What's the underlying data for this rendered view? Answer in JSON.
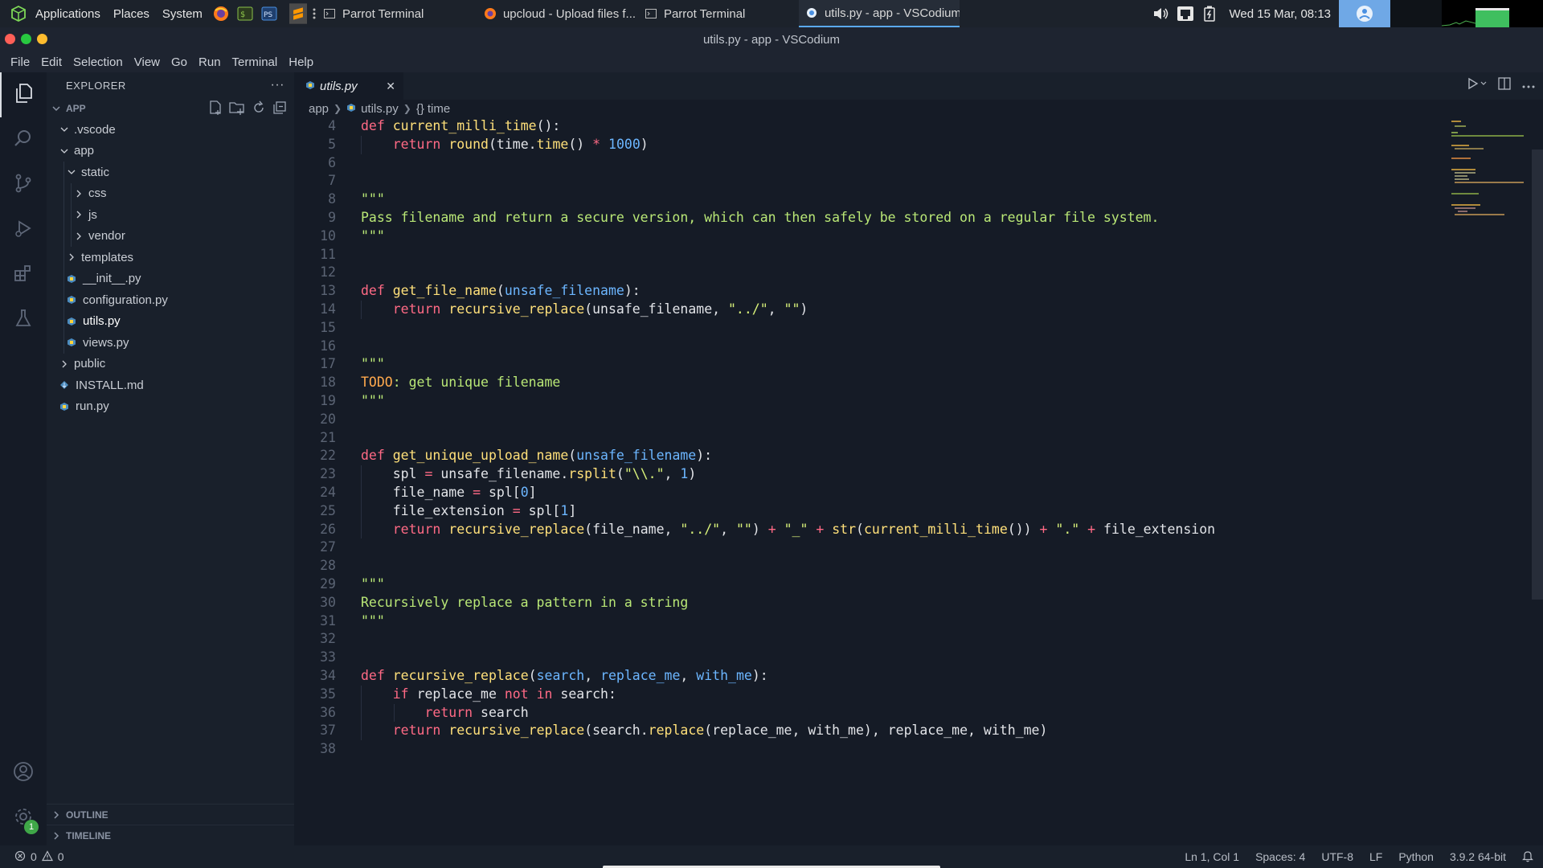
{
  "os_panel": {
    "menus": [
      "Applications",
      "Places",
      "System"
    ],
    "tasks": [
      {
        "label": "Parrot Terminal",
        "icon": "terminal-icon",
        "active": false
      },
      {
        "label": "upcloud - Upload files f...",
        "icon": "firefox-icon",
        "active": false
      },
      {
        "label": "Parrot Terminal",
        "icon": "terminal-icon",
        "active": false
      },
      {
        "label": "utils.py - app - VSCodium",
        "icon": "vscodium-icon",
        "active": true
      }
    ],
    "clock": "Wed 15 Mar, 08:13"
  },
  "window": {
    "title": "utils.py - app - VSCodium"
  },
  "menubar": [
    "File",
    "Edit",
    "Selection",
    "View",
    "Go",
    "Run",
    "Terminal",
    "Help"
  ],
  "sidebar": {
    "title": "EXPLORER",
    "more": "···",
    "section": "APP",
    "tree": [
      {
        "label": ".vscode",
        "type": "folder",
        "open": true,
        "depth": 0
      },
      {
        "label": "app",
        "type": "folder",
        "open": true,
        "depth": 0
      },
      {
        "label": "static",
        "type": "folder",
        "open": true,
        "depth": 1
      },
      {
        "label": "css",
        "type": "folder",
        "open": false,
        "depth": 2
      },
      {
        "label": "js",
        "type": "folder",
        "open": false,
        "depth": 2
      },
      {
        "label": "vendor",
        "type": "folder",
        "open": false,
        "depth": 2
      },
      {
        "label": "templates",
        "type": "folder",
        "open": false,
        "depth": 1
      },
      {
        "label": "__init__.py",
        "type": "py",
        "depth": 1
      },
      {
        "label": "configuration.py",
        "type": "py",
        "depth": 1
      },
      {
        "label": "utils.py",
        "type": "py",
        "depth": 1,
        "active": true
      },
      {
        "label": "views.py",
        "type": "py",
        "depth": 1
      },
      {
        "label": "public",
        "type": "folder",
        "open": false,
        "depth": 0
      },
      {
        "label": "INSTALL.md",
        "type": "md",
        "depth": 0
      },
      {
        "label": "run.py",
        "type": "py",
        "depth": 0
      }
    ],
    "outline": "OUTLINE",
    "timeline": "TIMELINE"
  },
  "editor": {
    "tab": {
      "label": "utils.py",
      "close": "✕"
    },
    "breadcrumb": {
      "folder": "app",
      "file": "utils.py",
      "symbol": "time"
    },
    "lines": [
      {
        "n": "4",
        "tokens": [
          [
            "kw",
            "def "
          ],
          [
            "fn",
            "current_milli_time"
          ],
          [
            "df",
            "():"
          ]
        ]
      },
      {
        "n": "5",
        "tokens": [
          [
            "df",
            "    "
          ],
          [
            "kw",
            "return "
          ],
          [
            "fn",
            "round"
          ],
          [
            "df",
            "(time."
          ],
          [
            "fn",
            "time"
          ],
          [
            "df",
            "() "
          ],
          [
            "op",
            "* "
          ],
          [
            "nm",
            "1000"
          ],
          [
            "df",
            ")"
          ]
        ]
      },
      {
        "n": "6",
        "tokens": []
      },
      {
        "n": "7",
        "tokens": []
      },
      {
        "n": "8",
        "tokens": [
          [
            "cm",
            "\"\"\""
          ]
        ]
      },
      {
        "n": "9",
        "tokens": [
          [
            "cm",
            "Pass filename and return a secure version, which can then safely be stored on a regular file system."
          ]
        ]
      },
      {
        "n": "10",
        "tokens": [
          [
            "cm",
            "\"\"\""
          ]
        ]
      },
      {
        "n": "11",
        "tokens": []
      },
      {
        "n": "12",
        "tokens": []
      },
      {
        "n": "13",
        "tokens": [
          [
            "kw",
            "def "
          ],
          [
            "fn",
            "get_file_name"
          ],
          [
            "df",
            "("
          ],
          [
            "pm",
            "unsafe_filename"
          ],
          [
            "df",
            "):"
          ]
        ]
      },
      {
        "n": "14",
        "tokens": [
          [
            "df",
            "    "
          ],
          [
            "kw",
            "return "
          ],
          [
            "fn",
            "recursive_replace"
          ],
          [
            "df",
            "(unsafe_filename, "
          ],
          [
            "st",
            "\"../\""
          ],
          [
            "df",
            ", "
          ],
          [
            "st",
            "\"\""
          ],
          [
            "df",
            ")"
          ]
        ]
      },
      {
        "n": "15",
        "tokens": []
      },
      {
        "n": "16",
        "tokens": []
      },
      {
        "n": "17",
        "tokens": [
          [
            "cm",
            "\"\"\""
          ]
        ]
      },
      {
        "n": "18",
        "tokens": [
          [
            "todo",
            "TODO"
          ],
          [
            "cm",
            ": get unique filename"
          ]
        ]
      },
      {
        "n": "19",
        "tokens": [
          [
            "cm",
            "\"\"\""
          ]
        ]
      },
      {
        "n": "20",
        "tokens": []
      },
      {
        "n": "21",
        "tokens": []
      },
      {
        "n": "22",
        "tokens": [
          [
            "kw",
            "def "
          ],
          [
            "fn",
            "get_unique_upload_name"
          ],
          [
            "df",
            "("
          ],
          [
            "pm",
            "unsafe_filename"
          ],
          [
            "df",
            "):"
          ]
        ]
      },
      {
        "n": "23",
        "tokens": [
          [
            "df",
            "    spl "
          ],
          [
            "op",
            "= "
          ],
          [
            "df",
            "unsafe_filename."
          ],
          [
            "fn",
            "rsplit"
          ],
          [
            "df",
            "("
          ],
          [
            "st",
            "\"\\\\.\""
          ],
          [
            "df",
            ", "
          ],
          [
            "nm",
            "1"
          ],
          [
            "df",
            ")"
          ]
        ]
      },
      {
        "n": "24",
        "tokens": [
          [
            "df",
            "    file_name "
          ],
          [
            "op",
            "= "
          ],
          [
            "df",
            "spl["
          ],
          [
            "nm",
            "0"
          ],
          [
            "df",
            "]"
          ]
        ]
      },
      {
        "n": "25",
        "tokens": [
          [
            "df",
            "    file_extension "
          ],
          [
            "op",
            "= "
          ],
          [
            "df",
            "spl["
          ],
          [
            "nm",
            "1"
          ],
          [
            "df",
            "]"
          ]
        ]
      },
      {
        "n": "26",
        "tokens": [
          [
            "df",
            "    "
          ],
          [
            "kw",
            "return "
          ],
          [
            "fn",
            "recursive_replace"
          ],
          [
            "df",
            "(file_name, "
          ],
          [
            "st",
            "\"../\""
          ],
          [
            "df",
            ", "
          ],
          [
            "st",
            "\"\""
          ],
          [
            "df",
            ") "
          ],
          [
            "op",
            "+ "
          ],
          [
            "st",
            "\"_\" "
          ],
          [
            "op",
            "+ "
          ],
          [
            "fn",
            "str"
          ],
          [
            "df",
            "("
          ],
          [
            "fn",
            "current_milli_time"
          ],
          [
            "df",
            "()) "
          ],
          [
            "op",
            "+ "
          ],
          [
            "st",
            "\".\" "
          ],
          [
            "op",
            "+ "
          ],
          [
            "df",
            "file_extension"
          ]
        ]
      },
      {
        "n": "27",
        "tokens": []
      },
      {
        "n": "28",
        "tokens": []
      },
      {
        "n": "29",
        "tokens": [
          [
            "cm",
            "\"\"\""
          ]
        ]
      },
      {
        "n": "30",
        "tokens": [
          [
            "cm",
            "Recursively replace a pattern in a string"
          ]
        ]
      },
      {
        "n": "31",
        "tokens": [
          [
            "cm",
            "\"\"\""
          ]
        ]
      },
      {
        "n": "32",
        "tokens": []
      },
      {
        "n": "33",
        "tokens": []
      },
      {
        "n": "34",
        "tokens": [
          [
            "kw",
            "def "
          ],
          [
            "fn",
            "recursive_replace"
          ],
          [
            "df",
            "("
          ],
          [
            "pm",
            "search"
          ],
          [
            "df",
            ", "
          ],
          [
            "pm",
            "replace_me"
          ],
          [
            "df",
            ", "
          ],
          [
            "pm",
            "with_me"
          ],
          [
            "df",
            "):"
          ]
        ]
      },
      {
        "n": "35",
        "tokens": [
          [
            "df",
            "    "
          ],
          [
            "kw",
            "if "
          ],
          [
            "df",
            "replace_me "
          ],
          [
            "kw",
            "not in "
          ],
          [
            "df",
            "search:"
          ]
        ]
      },
      {
        "n": "36",
        "tokens": [
          [
            "df",
            "        "
          ],
          [
            "kw",
            "return "
          ],
          [
            "df",
            "search"
          ]
        ]
      },
      {
        "n": "37",
        "tokens": [
          [
            "df",
            "    "
          ],
          [
            "kw",
            "return "
          ],
          [
            "fn",
            "recursive_replace"
          ],
          [
            "df",
            "(search."
          ],
          [
            "fn",
            "replace"
          ],
          [
            "df",
            "(replace_me, with_me), replace_me, with_me)"
          ]
        ]
      },
      {
        "n": "38",
        "tokens": []
      }
    ]
  },
  "statusbar": {
    "errors": "0",
    "warnings": "0",
    "position": "Ln 1, Col 1",
    "spaces": "Spaces: 4",
    "encoding": "UTF-8",
    "eol": "LF",
    "language": "Python",
    "interpreter": "3.9.2 64-bit"
  },
  "activity": {
    "settings_badge": "1"
  },
  "colors": {
    "accent": "#5aa9f0",
    "keyword": "#ff6a85",
    "function": "#ffe07a",
    "comment": "#b9e776",
    "number": "#6cb6ff",
    "badge": "#3fa748"
  }
}
